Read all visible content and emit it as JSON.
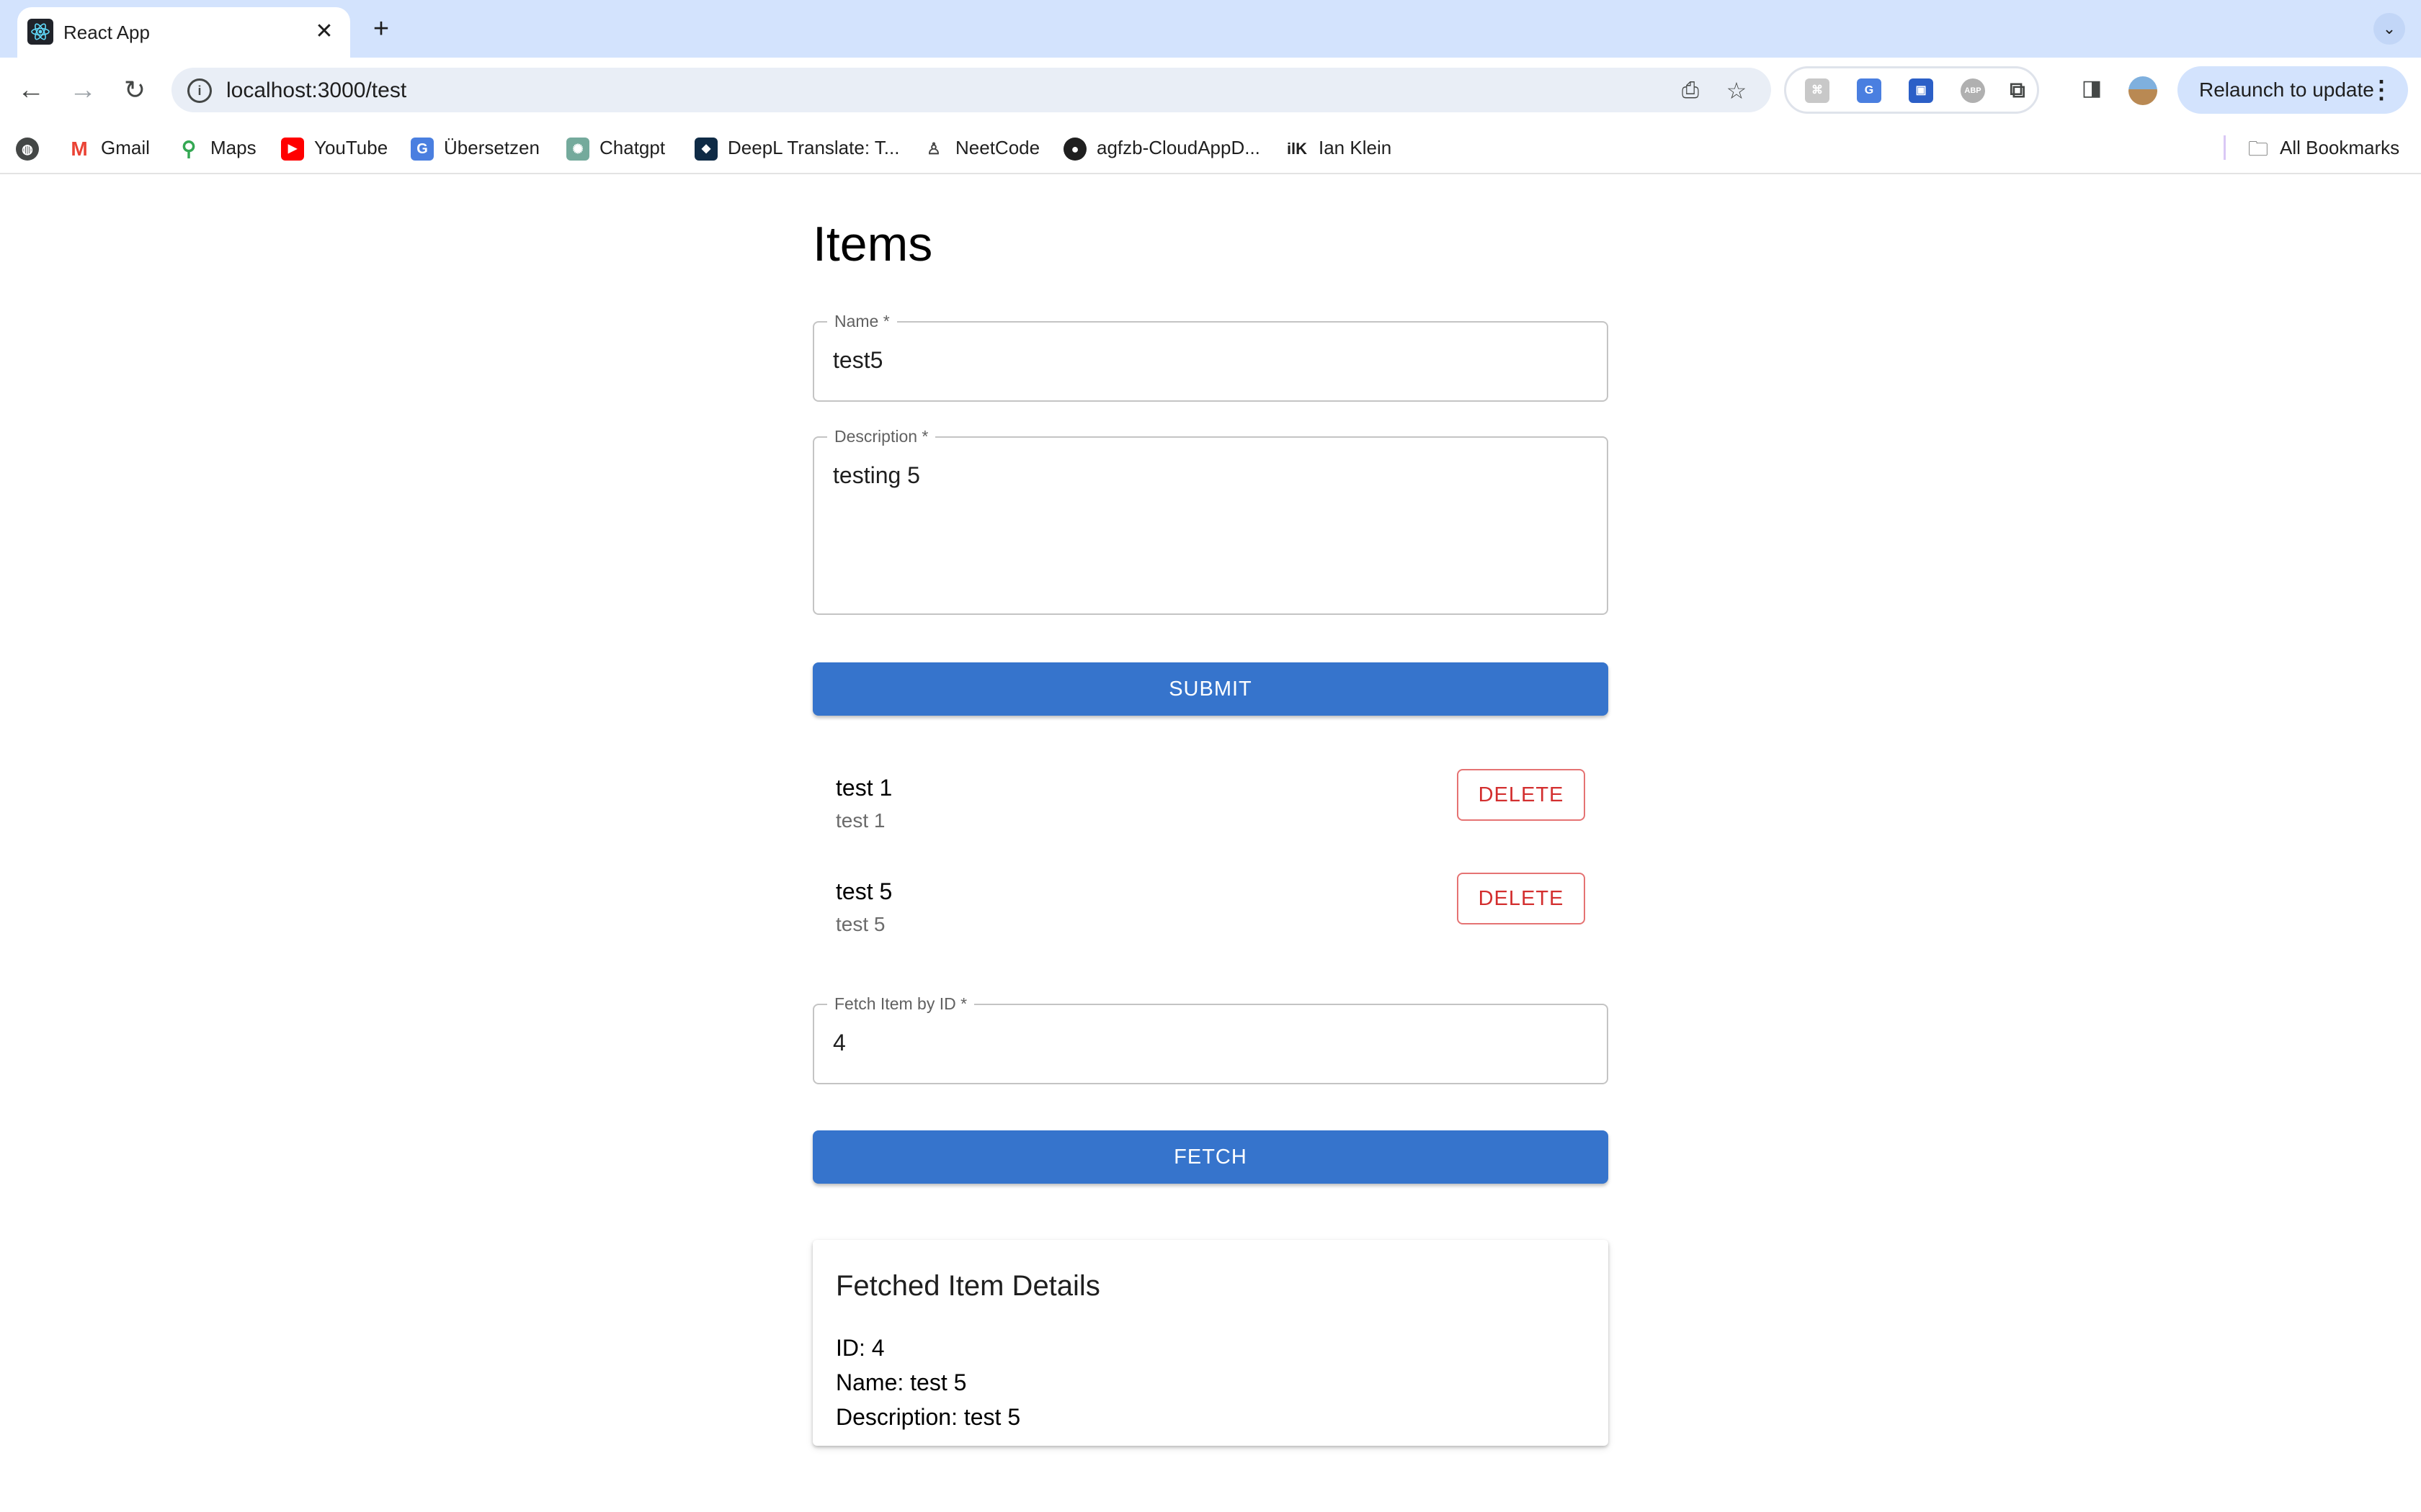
{
  "browser": {
    "tab_title": "React App",
    "tab_close": "✕",
    "new_tab": "+",
    "tab_menu": "⌄",
    "url": "localhost:3000/test",
    "relaunch_label": "Relaunch to update",
    "bookmarks": [
      {
        "label": "Gmail",
        "icon": "gmail-icon"
      },
      {
        "label": "Maps",
        "icon": "maps-icon"
      },
      {
        "label": "YouTube",
        "icon": "youtube-icon"
      },
      {
        "label": "Übersetzen",
        "icon": "translate-icon"
      },
      {
        "label": "Chatgpt",
        "icon": "chatgpt-icon"
      },
      {
        "label": "DeepL Translate: T...",
        "icon": "deepl-icon"
      },
      {
        "label": "NeetCode",
        "icon": "neetcode-icon"
      },
      {
        "label": "agfzb-CloudAppD...",
        "icon": "github-icon"
      },
      {
        "label": "Ian Klein",
        "icon": "ilk-icon"
      }
    ],
    "all_bookmarks": "All Bookmarks"
  },
  "page": {
    "title": "Items",
    "name_field": {
      "label": "Name *",
      "value": "test5"
    },
    "description_field": {
      "label": "Description *",
      "value": "testing 5"
    },
    "submit_label": "SUBMIT",
    "items": [
      {
        "name": "test 1",
        "description": "test 1",
        "delete_label": "DELETE"
      },
      {
        "name": "test 5",
        "description": "test 5",
        "delete_label": "DELETE"
      }
    ],
    "fetch_field": {
      "label": "Fetch Item by ID *",
      "value": "4"
    },
    "fetch_label": "FETCH",
    "fetched": {
      "title": "Fetched Item Details",
      "id_line": "ID: 4",
      "name_line": "Name: test 5",
      "description_line": "Description: test 5"
    }
  },
  "colors": {
    "primary": "#3674cc",
    "delete": "#d32f2f",
    "tabstrip": "#d3e3fd"
  }
}
